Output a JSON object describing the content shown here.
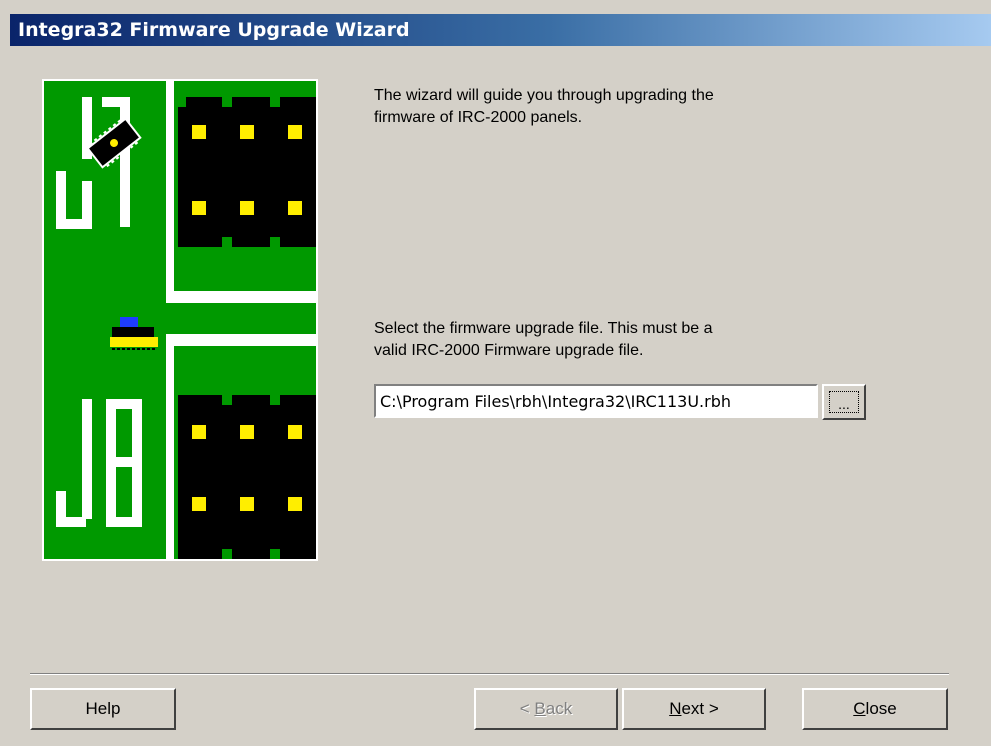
{
  "window": {
    "title": "Integra32 Firmware Upgrade Wizard"
  },
  "intro": {
    "line1": "The wizard will guide you through upgrading the",
    "line2": "firmware of IRC-2000 panels."
  },
  "select": {
    "line1": "Select the firmware upgrade file. This must be a",
    "line2": "valid IRC-2000 Firmware upgrade file."
  },
  "file_path": {
    "value": "C:\\Program Files\\rbh\\Integra32\\IRC113U.rbh"
  },
  "browse_button": {
    "label": "..."
  },
  "buttons": {
    "help": "Help",
    "back_prefix": "< ",
    "back_mnemonic": "B",
    "back_rest": "ack",
    "next_mnemonic": "N",
    "next_rest": "ext >",
    "close_mnemonic": "C",
    "close_rest": "lose"
  },
  "illustration": {
    "jumper_top": "J7",
    "jumper_bottom": "J8"
  },
  "colors": {
    "pcb_green": "#009900",
    "pin_yellow": "#ffee00",
    "title_start": "#0a246a",
    "title_end": "#a6caf0"
  }
}
